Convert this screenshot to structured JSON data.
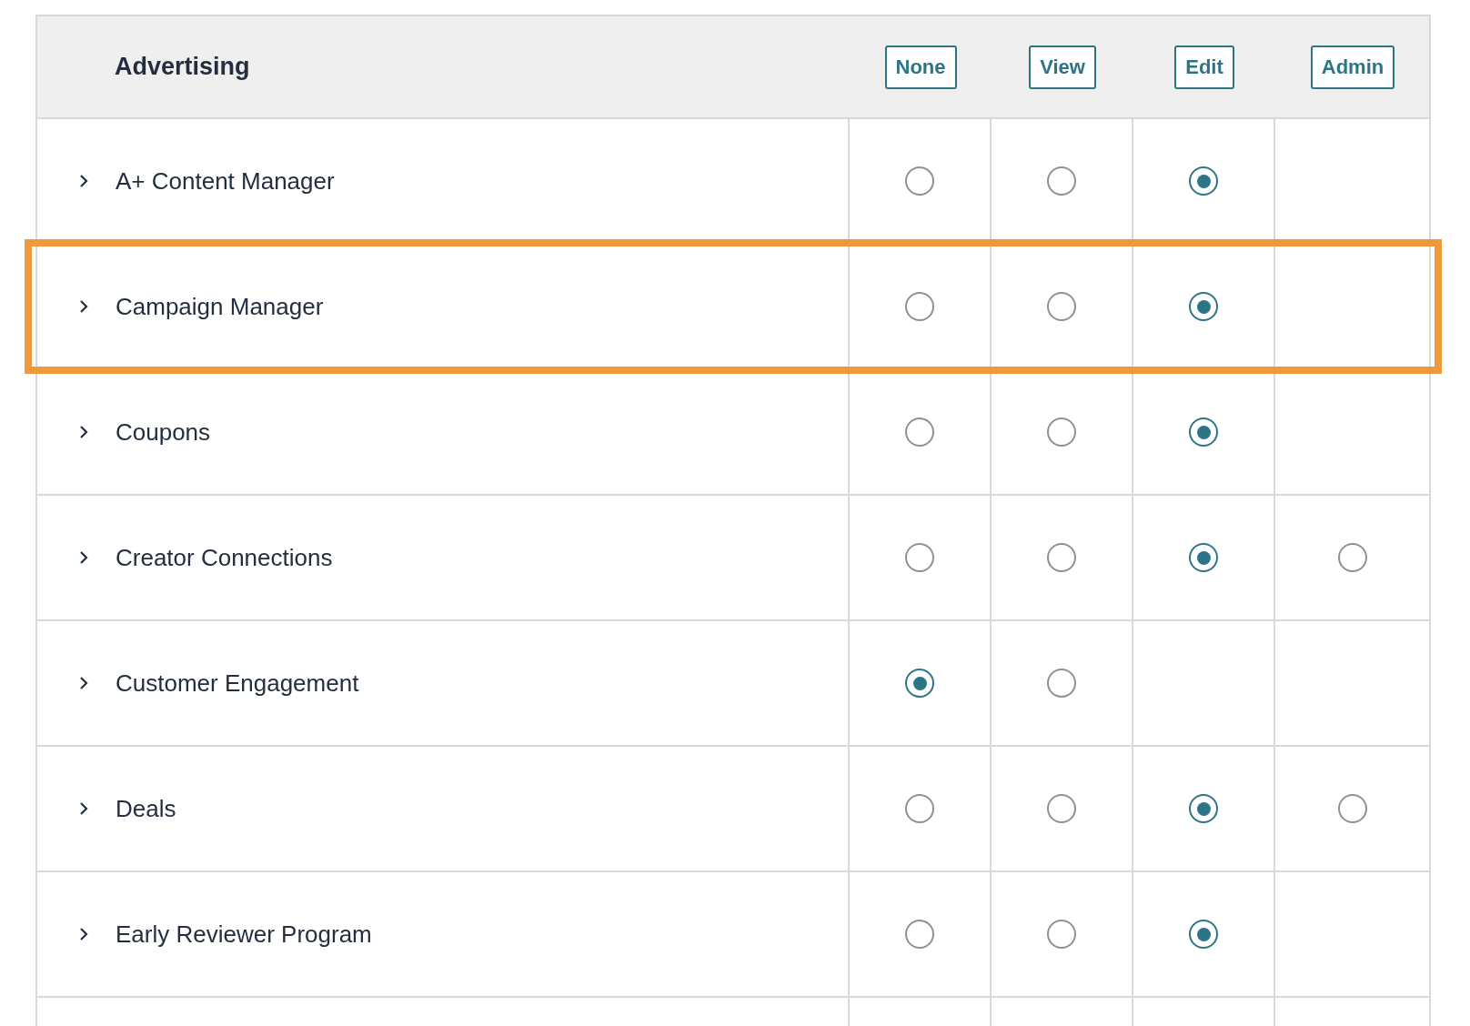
{
  "section": {
    "title": "Advertising",
    "levels": [
      "None",
      "View",
      "Edit",
      "Admin"
    ]
  },
  "rows": [
    {
      "name": "A+ Content Manager",
      "highlighted": false,
      "options": [
        {
          "kind": "radio",
          "selected": false
        },
        {
          "kind": "radio",
          "selected": false
        },
        {
          "kind": "radio",
          "selected": true
        },
        {
          "kind": "empty"
        }
      ]
    },
    {
      "name": "Campaign Manager",
      "highlighted": true,
      "options": [
        {
          "kind": "radio",
          "selected": false
        },
        {
          "kind": "radio",
          "selected": false
        },
        {
          "kind": "radio",
          "selected": true
        },
        {
          "kind": "empty"
        }
      ]
    },
    {
      "name": "Coupons",
      "highlighted": false,
      "options": [
        {
          "kind": "radio",
          "selected": false
        },
        {
          "kind": "radio",
          "selected": false
        },
        {
          "kind": "radio",
          "selected": true
        },
        {
          "kind": "empty"
        }
      ]
    },
    {
      "name": "Creator Connections",
      "highlighted": false,
      "options": [
        {
          "kind": "radio",
          "selected": false
        },
        {
          "kind": "radio",
          "selected": false
        },
        {
          "kind": "radio",
          "selected": true
        },
        {
          "kind": "radio",
          "selected": false
        }
      ]
    },
    {
      "name": "Customer Engagement",
      "highlighted": false,
      "options": [
        {
          "kind": "radio",
          "selected": true
        },
        {
          "kind": "radio",
          "selected": false
        },
        {
          "kind": "empty"
        },
        {
          "kind": "empty"
        }
      ]
    },
    {
      "name": "Deals",
      "highlighted": false,
      "options": [
        {
          "kind": "radio",
          "selected": false
        },
        {
          "kind": "radio",
          "selected": false
        },
        {
          "kind": "radio",
          "selected": true
        },
        {
          "kind": "radio",
          "selected": false
        }
      ]
    },
    {
      "name": "Early Reviewer Program",
      "highlighted": false,
      "options": [
        {
          "kind": "radio",
          "selected": false
        },
        {
          "kind": "radio",
          "selected": false
        },
        {
          "kind": "radio",
          "selected": true
        },
        {
          "kind": "empty"
        }
      ]
    }
  ]
}
